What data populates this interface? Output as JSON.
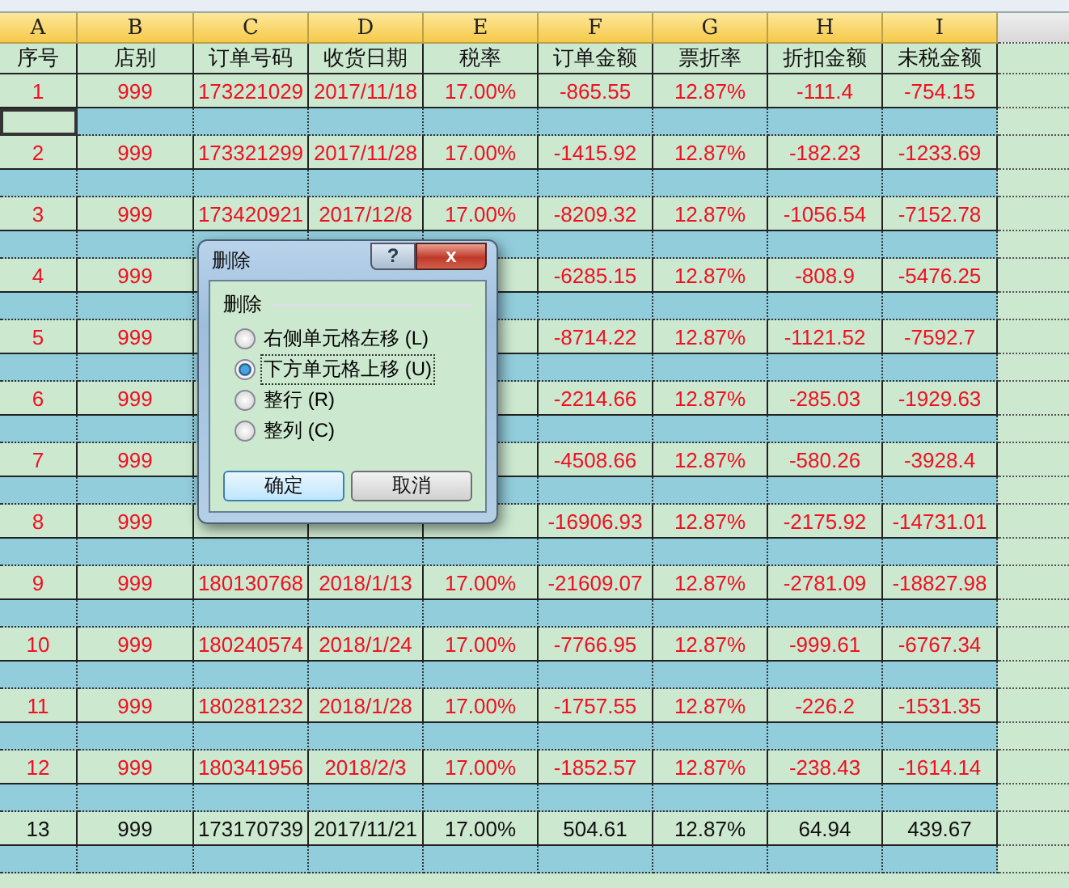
{
  "column_letters": [
    "A",
    "B",
    "C",
    "D",
    "E",
    "F",
    "G",
    "H",
    "I"
  ],
  "header_row": [
    "序号",
    "店别",
    "订单号码",
    "收货日期",
    "税率",
    "订单金额",
    "票折率",
    "折扣金额",
    "未税金额"
  ],
  "rows": [
    {
      "kind": "data",
      "flagged": true,
      "cells": [
        "1",
        "999",
        "173221029",
        "2017/11/18",
        "17.00%",
        "-865.55",
        "12.87%",
        "-111.4",
        "-754.15"
      ]
    },
    {
      "kind": "blank",
      "selected": true
    },
    {
      "kind": "data",
      "flagged": true,
      "cells": [
        "2",
        "999",
        "173321299",
        "2017/11/28",
        "17.00%",
        "-1415.92",
        "12.87%",
        "-182.23",
        "-1233.69"
      ]
    },
    {
      "kind": "blank",
      "selected": false
    },
    {
      "kind": "data",
      "flagged": true,
      "cells": [
        "3",
        "999",
        "173420921",
        "2017/12/8",
        "17.00%",
        "-8209.32",
        "12.87%",
        "-1056.54",
        "-7152.78"
      ]
    },
    {
      "kind": "blank",
      "selected": false
    },
    {
      "kind": "data",
      "flagged": true,
      "cells": [
        "4",
        "999",
        null,
        null,
        null,
        "-6285.15",
        "12.87%",
        "-808.9",
        "-5476.25"
      ]
    },
    {
      "kind": "blank",
      "selected": false
    },
    {
      "kind": "data",
      "flagged": true,
      "cells": [
        "5",
        "999",
        null,
        null,
        null,
        "-8714.22",
        "12.87%",
        "-1121.52",
        "-7592.7"
      ]
    },
    {
      "kind": "blank",
      "selected": false
    },
    {
      "kind": "data",
      "flagged": true,
      "cells": [
        "6",
        "999",
        null,
        null,
        null,
        "-2214.66",
        "12.87%",
        "-285.03",
        "-1929.63"
      ]
    },
    {
      "kind": "blank",
      "selected": false
    },
    {
      "kind": "data",
      "flagged": true,
      "cells": [
        "7",
        "999",
        null,
        null,
        null,
        "-4508.66",
        "12.87%",
        "-580.26",
        "-3928.4"
      ]
    },
    {
      "kind": "blank",
      "selected": false
    },
    {
      "kind": "data",
      "flagged": true,
      "cells": [
        "8",
        "999",
        null,
        null,
        null,
        "-16906.93",
        "12.87%",
        "-2175.92",
        "-14731.01"
      ]
    },
    {
      "kind": "blank",
      "selected": false
    },
    {
      "kind": "data",
      "flagged": true,
      "cells": [
        "9",
        "999",
        "180130768",
        "2018/1/13",
        "17.00%",
        "-21609.07",
        "12.87%",
        "-2781.09",
        "-18827.98"
      ]
    },
    {
      "kind": "blank",
      "selected": false
    },
    {
      "kind": "data",
      "flagged": true,
      "cells": [
        "10",
        "999",
        "180240574",
        "2018/1/24",
        "17.00%",
        "-7766.95",
        "12.87%",
        "-999.61",
        "-6767.34"
      ]
    },
    {
      "kind": "blank",
      "selected": false
    },
    {
      "kind": "data",
      "flagged": true,
      "cells": [
        "11",
        "999",
        "180281232",
        "2018/1/28",
        "17.00%",
        "-1757.55",
        "12.87%",
        "-226.2",
        "-1531.35"
      ]
    },
    {
      "kind": "blank",
      "selected": false
    },
    {
      "kind": "data",
      "flagged": true,
      "cells": [
        "12",
        "999",
        "180341956",
        "2018/2/3",
        "17.00%",
        "-1852.57",
        "12.87%",
        "-238.43",
        "-1614.14"
      ]
    },
    {
      "kind": "blank",
      "selected": false
    },
    {
      "kind": "data",
      "flagged": false,
      "cells": [
        "13",
        "999",
        "173170739",
        "2017/11/21",
        "17.00%",
        "504.61",
        "12.87%",
        "64.94",
        "439.67"
      ]
    },
    {
      "kind": "blank",
      "selected": false
    }
  ],
  "dialog": {
    "title": "删除",
    "help": "?",
    "close": "x",
    "group_label": "删除",
    "options": [
      {
        "label": "右侧单元格左移 (L)",
        "selected": false
      },
      {
        "label": "下方单元格上移 (U)",
        "selected": true
      },
      {
        "label": "整行 (R)",
        "selected": false
      },
      {
        "label": "整列 (C)",
        "selected": false
      }
    ],
    "buttons": [
      {
        "label": "确定",
        "default": true
      },
      {
        "label": "取消",
        "default": false
      }
    ]
  }
}
